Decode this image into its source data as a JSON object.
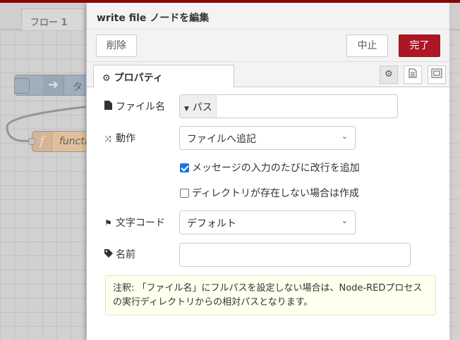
{
  "workspace": {
    "flow_tab_label": "フロー 1",
    "nodes": {
      "inject_label": "タイム",
      "function_label": "function"
    }
  },
  "tray": {
    "title": "write file ノードを編集",
    "buttons": {
      "delete": "削除",
      "cancel": "中止",
      "done": "完了"
    },
    "tabs": {
      "properties": "プロパティ"
    },
    "form": {
      "filename_label": "ファイル名",
      "filename_type": "パス",
      "filename_value": "",
      "action_label": "動作",
      "action_value": "ファイルへ追記",
      "append_newline_label": "メッセージの入力のたびに改行を追加",
      "append_newline_checked": true,
      "create_dir_label": "ディレクトリが存在しない場合は作成",
      "create_dir_checked": false,
      "encoding_label": "文字コード",
      "encoding_value": "デフォルト",
      "name_label": "名前",
      "name_value": ""
    },
    "tip": "注釈: 「ファイル名」にフルパスを設定しない場合は、Node-REDプロセスの実行ディレクトリからの相対パスとなります。"
  },
  "colors": {
    "accent": "#ad1625",
    "topbar": "#8f0000",
    "checkbox": "#1a73e8",
    "tip_bg": "#ffffee"
  }
}
